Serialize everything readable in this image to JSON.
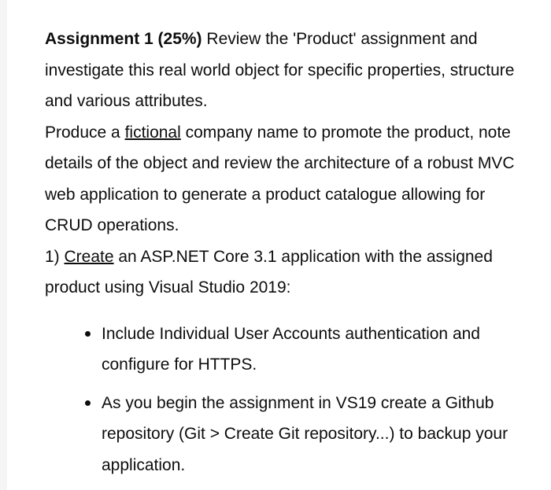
{
  "document": {
    "assignment_heading": "Assignment 1 (25%)",
    "intro_text": " Review the 'Product' assignment and investigate this real world object for specific properties, structure and various attributes.",
    "paragraph2": {
      "before_underline": "Produce a ",
      "underlined_word": "fictional",
      "after_underline": " company name to promote the product, note details of the object and review the architecture of a robust MVC web application to generate a product catalogue allowing for CRUD operations."
    },
    "numbered_item": {
      "number": "1) ",
      "underlined_word": "Create",
      "rest": " an ASP.NET Core 3.1 application with the assigned product using Visual Studio 2019:"
    },
    "bullets": [
      "Include Individual User Accounts authentication and configure for HTTPS.",
      "As you begin the assignment in VS19 create a Github repository (Git > Create Git repository...) to backup your application."
    ]
  },
  "colors": {
    "text": "#0d0d0d",
    "background": "#ffffff",
    "gutter": "#f5f5f5",
    "scrollbar_thumb": "#f2f2f2"
  }
}
